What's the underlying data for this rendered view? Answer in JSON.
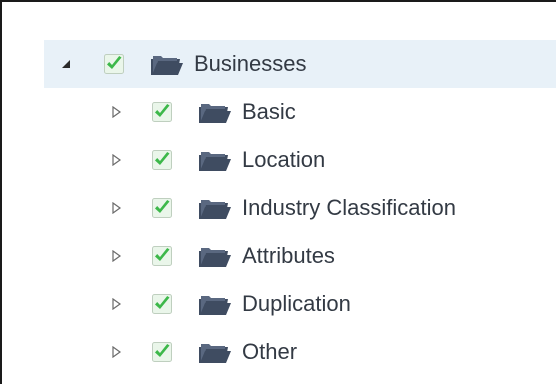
{
  "tree": {
    "root": {
      "label": "Businesses",
      "expanded": true,
      "checked": true,
      "expander_icon": "triangle-expanded-icon",
      "checkbox_icon": "checkbox-checked-icon",
      "folder_icon": "folder-open-icon"
    },
    "children": [
      {
        "label": "Basic",
        "checked": true
      },
      {
        "label": "Location",
        "checked": true
      },
      {
        "label": "Industry Classification",
        "checked": true
      },
      {
        "label": "Attributes",
        "checked": true
      },
      {
        "label": "Duplication",
        "checked": true
      },
      {
        "label": "Other",
        "checked": true
      }
    ]
  },
  "colors": {
    "selected_row_bg": "#e8f1f8",
    "check_green": "#3db84a",
    "folder": "#3f4c61",
    "text": "#333a44",
    "expander": "#555555"
  }
}
